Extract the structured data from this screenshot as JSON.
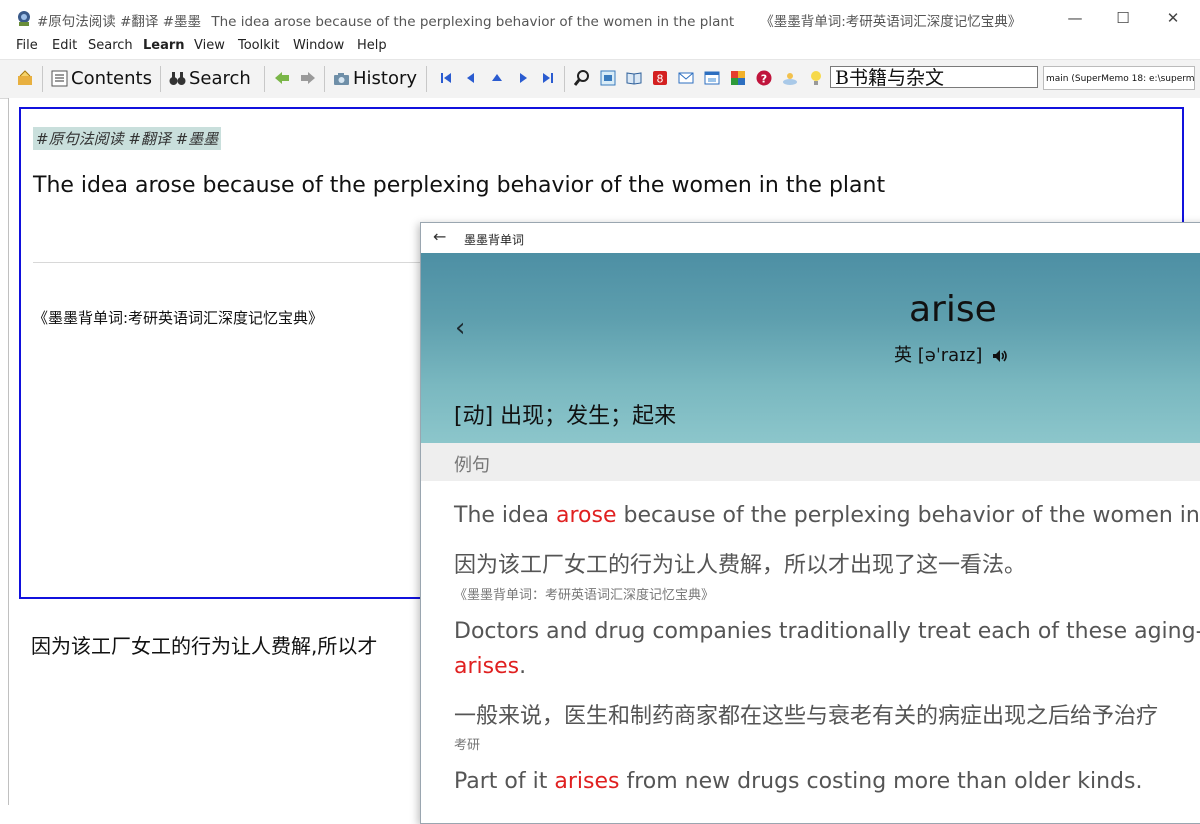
{
  "window": {
    "title_tags": "#原句法阅读 #翻译 #墨墨",
    "title_text": "The idea arose because of the perplexing behavior of the women in the plant",
    "title_source": "《墨墨背单词:考研英语词汇深度记忆宝典》",
    "minimize": "—",
    "maximize": "☐",
    "close": "✕"
  },
  "menu": [
    "File",
    "Edit",
    "Search",
    "Learn",
    "View",
    "Toolkit",
    "Window",
    "Help"
  ],
  "toolbar": {
    "contents_label": "Contents",
    "search_label": "Search",
    "history_label": "History",
    "branch_value": "B书籍与杂文",
    "collection_value": "main (SuperMemo 18: e:\\supermem"
  },
  "element": {
    "tags": "#原句法阅读 #翻译 #墨墨",
    "question": "The idea arose because of the perplexing behavior of the women in the plant",
    "source": "《墨墨背单词:考研英语词汇深度记忆宝典》",
    "answer": "因为该工厂女工的行为让人费解,所以才"
  },
  "dictionary": {
    "window_title": "墨墨背单词",
    "back_arrow": "←",
    "prev": "‹",
    "word": "arise",
    "phonetic": "英 [əˈraɪz]",
    "definition": "[动] 出现；发生；起来",
    "examples_header": "例句",
    "examples": [
      {
        "en_before": "The idea ",
        "en_hl": "arose",
        "en_after": " because of the perplexing behavior of the women in the",
        "en_line2_hl": "",
        "en_line2_after": "",
        "zh": "因为该工厂女工的行为让人费解，所以才出现了这一看法。",
        "src": "《墨墨背单词：考研英语词汇深度记忆宝典》"
      },
      {
        "en_before": "Doctors and drug companies traditionally treat each of these aging-relat",
        "en_hl": "",
        "en_after": "",
        "en_line2_hl": "arises",
        "en_line2_after": ".",
        "zh": "一般来说，医生和制药商家都在这些与衰老有关的病症出现之后给予治疗",
        "src": "考研"
      },
      {
        "en_before": "Part of it ",
        "en_hl": "arises",
        "en_after": " from new drugs costing more than older kinds.",
        "en_line2_hl": "",
        "en_line2_after": "",
        "zh": "",
        "src": ""
      }
    ]
  },
  "colors": {
    "frame_border": "#1111dd",
    "tag_highlight": "#c9dfdc",
    "highlight_word": "#e02020",
    "dictionary_header": "#5e9fae"
  }
}
